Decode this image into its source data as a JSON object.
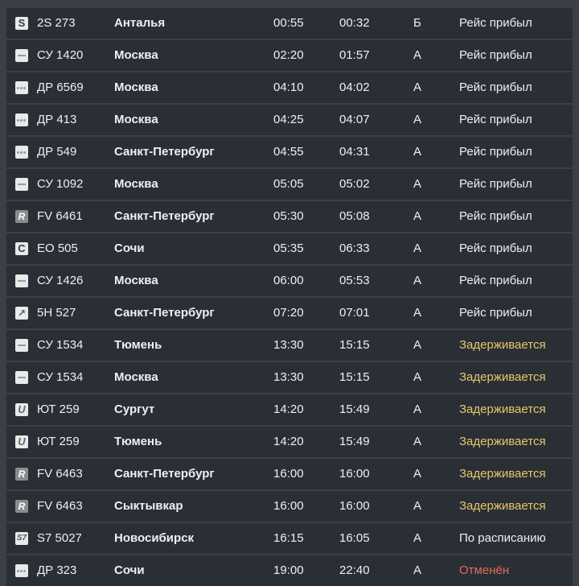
{
  "colors": {
    "row_background": "#2a2f36",
    "page_background": "#3b4048",
    "status_arrived": "#eef0f2",
    "status_delayed": "#e8c66a",
    "status_cancelled": "#e36b5a"
  },
  "flights": [
    {
      "logo": "airline-logo-s-icon",
      "logo_glyph": "S",
      "flight": "2S 273",
      "city": "Анталья",
      "scheduled": "00:55",
      "actual": "00:32",
      "terminal": "Б",
      "status": "Рейс прибыл",
      "status_kind": "arrived"
    },
    {
      "logo": "airline-logo-dash-icon",
      "logo_glyph": "",
      "flight": "СУ 1420",
      "city": "Москва",
      "scheduled": "02:20",
      "actual": "01:57",
      "terminal": "A",
      "status": "Рейс прибыл",
      "status_kind": "arrived"
    },
    {
      "logo": "airline-logo-dots-icon",
      "logo_glyph": "",
      "flight": "ДР 6569",
      "city": "Москва",
      "scheduled": "04:10",
      "actual": "04:02",
      "terminal": "A",
      "status": "Рейс прибыл",
      "status_kind": "arrived"
    },
    {
      "logo": "airline-logo-dots-icon",
      "logo_glyph": "",
      "flight": "ДР 413",
      "city": "Москва",
      "scheduled": "04:25",
      "actual": "04:07",
      "terminal": "A",
      "status": "Рейс прибыл",
      "status_kind": "arrived"
    },
    {
      "logo": "airline-logo-dots-icon",
      "logo_glyph": "",
      "flight": "ДР 549",
      "city": "Санкт-Петербург",
      "scheduled": "04:55",
      "actual": "04:31",
      "terminal": "A",
      "status": "Рейс прибыл",
      "status_kind": "arrived"
    },
    {
      "logo": "airline-logo-dash-icon",
      "logo_glyph": "",
      "flight": "СУ 1092",
      "city": "Москва",
      "scheduled": "05:05",
      "actual": "05:02",
      "terminal": "A",
      "status": "Рейс прибыл",
      "status_kind": "arrived"
    },
    {
      "logo": "airline-logo-r-icon",
      "logo_glyph": "R",
      "flight": "FV 6461",
      "city": "Санкт-Петербург",
      "scheduled": "05:30",
      "actual": "05:08",
      "terminal": "A",
      "status": "Рейс прибыл",
      "status_kind": "arrived"
    },
    {
      "logo": "airline-logo-c-icon",
      "logo_glyph": "C",
      "flight": "ЕО 505",
      "city": "Сочи",
      "scheduled": "05:35",
      "actual": "06:33",
      "terminal": "A",
      "status": "Рейс прибыл",
      "status_kind": "arrived"
    },
    {
      "logo": "airline-logo-dash-icon",
      "logo_glyph": "",
      "flight": "СУ 1426",
      "city": "Москва",
      "scheduled": "06:00",
      "actual": "05:53",
      "terminal": "A",
      "status": "Рейс прибыл",
      "status_kind": "arrived"
    },
    {
      "logo": "airline-logo-nw-icon",
      "logo_glyph": "↗",
      "flight": "5Н 527",
      "city": "Санкт-Петербург",
      "scheduled": "07:20",
      "actual": "07:01",
      "terminal": "A",
      "status": "Рейс прибыл",
      "status_kind": "arrived"
    },
    {
      "logo": "airline-logo-dash-icon",
      "logo_glyph": "",
      "flight": "СУ 1534",
      "city": "Тюмень",
      "scheduled": "13:30",
      "actual": "15:15",
      "terminal": "A",
      "status": "Задерживается",
      "status_kind": "delayed"
    },
    {
      "logo": "airline-logo-dash-icon",
      "logo_glyph": "",
      "flight": "СУ 1534",
      "city": "Москва",
      "scheduled": "13:30",
      "actual": "15:15",
      "terminal": "A",
      "status": "Задерживается",
      "status_kind": "delayed"
    },
    {
      "logo": "airline-logo-u-icon",
      "logo_glyph": "U",
      "flight": "ЮТ 259",
      "city": "Сургут",
      "scheduled": "14:20",
      "actual": "15:49",
      "terminal": "A",
      "status": "Задерживается",
      "status_kind": "delayed"
    },
    {
      "logo": "airline-logo-u-icon",
      "logo_glyph": "U",
      "flight": "ЮТ 259",
      "city": "Тюмень",
      "scheduled": "14:20",
      "actual": "15:49",
      "terminal": "A",
      "status": "Задерживается",
      "status_kind": "delayed"
    },
    {
      "logo": "airline-logo-r-icon",
      "logo_glyph": "R",
      "flight": "FV 6463",
      "city": "Санкт-Петербург",
      "scheduled": "16:00",
      "actual": "16:00",
      "terminal": "A",
      "status": "Задерживается",
      "status_kind": "delayed"
    },
    {
      "logo": "airline-logo-r-icon",
      "logo_glyph": "R",
      "flight": "FV 6463",
      "city": "Сыктывкар",
      "scheduled": "16:00",
      "actual": "16:00",
      "terminal": "A",
      "status": "Задерживается",
      "status_kind": "delayed"
    },
    {
      "logo": "airline-logo-s7-icon",
      "logo_glyph": "S7",
      "flight": "S7 5027",
      "city": "Новосибирск",
      "scheduled": "16:15",
      "actual": "16:05",
      "terminal": "A",
      "status": "По расписанию",
      "status_kind": "scheduled"
    },
    {
      "logo": "airline-logo-dots-icon",
      "logo_glyph": "",
      "flight": "ДР 323",
      "city": "Сочи",
      "scheduled": "19:00",
      "actual": "22:40",
      "terminal": "A",
      "status": "Отменён",
      "status_kind": "cancelled"
    }
  ]
}
